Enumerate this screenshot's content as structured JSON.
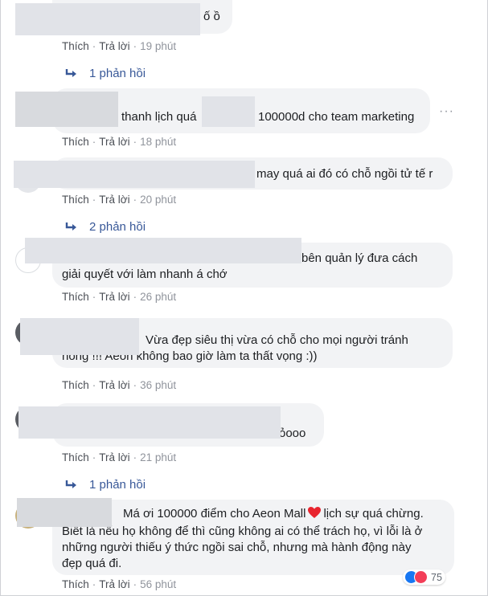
{
  "actions": {
    "like": "Thích",
    "reply": "Trả lời",
    "separator": "·"
  },
  "more_glyph": "···",
  "comments": [
    {
      "text": "ố ồ",
      "time": "19 phút",
      "replies": "1 phản hồi"
    },
    {
      "text_a": "thanh lịch quá",
      "text_b": "100000d cho team marketing",
      "time": "18 phút"
    },
    {
      "text": "may quá ai đó có chỗ ngồi tử tế r",
      "time": "20 phút",
      "replies": "2 phản hồi"
    },
    {
      "line1": "bên quản lý đưa cách",
      "line2": "giải quyết với làm nhanh á chớ",
      "time": "26 phút"
    },
    {
      "line1": "Vừa đẹp siêu thị vừa có chỗ cho mọi người tránh",
      "line2": "nóng !!! Aeon không bao giờ làm ta thất vọng :))",
      "time": "36 phút"
    },
    {
      "text": "ỏooo",
      "time": "21 phút",
      "replies": "1 phản hồi"
    },
    {
      "line1a": "Má ơi 100000 điểm cho Aeon Mall",
      "line1b": "lịch sự quá chừng.",
      "line2": "Biết là nếu họ không để thì cũng không ai có thể trách họ, vì lỗi là ở",
      "line3": "những người thiếu ý thức ngồi sai chỗ, nhưng mà hành động này",
      "line4": "đẹp quá đi.",
      "time": "56 phút",
      "reactions": "75"
    }
  ],
  "colors": {
    "link": "#385898",
    "bubble": "#f2f3f5",
    "meta": "#90949c",
    "like": "#1877f2",
    "love": "#f33e58"
  }
}
